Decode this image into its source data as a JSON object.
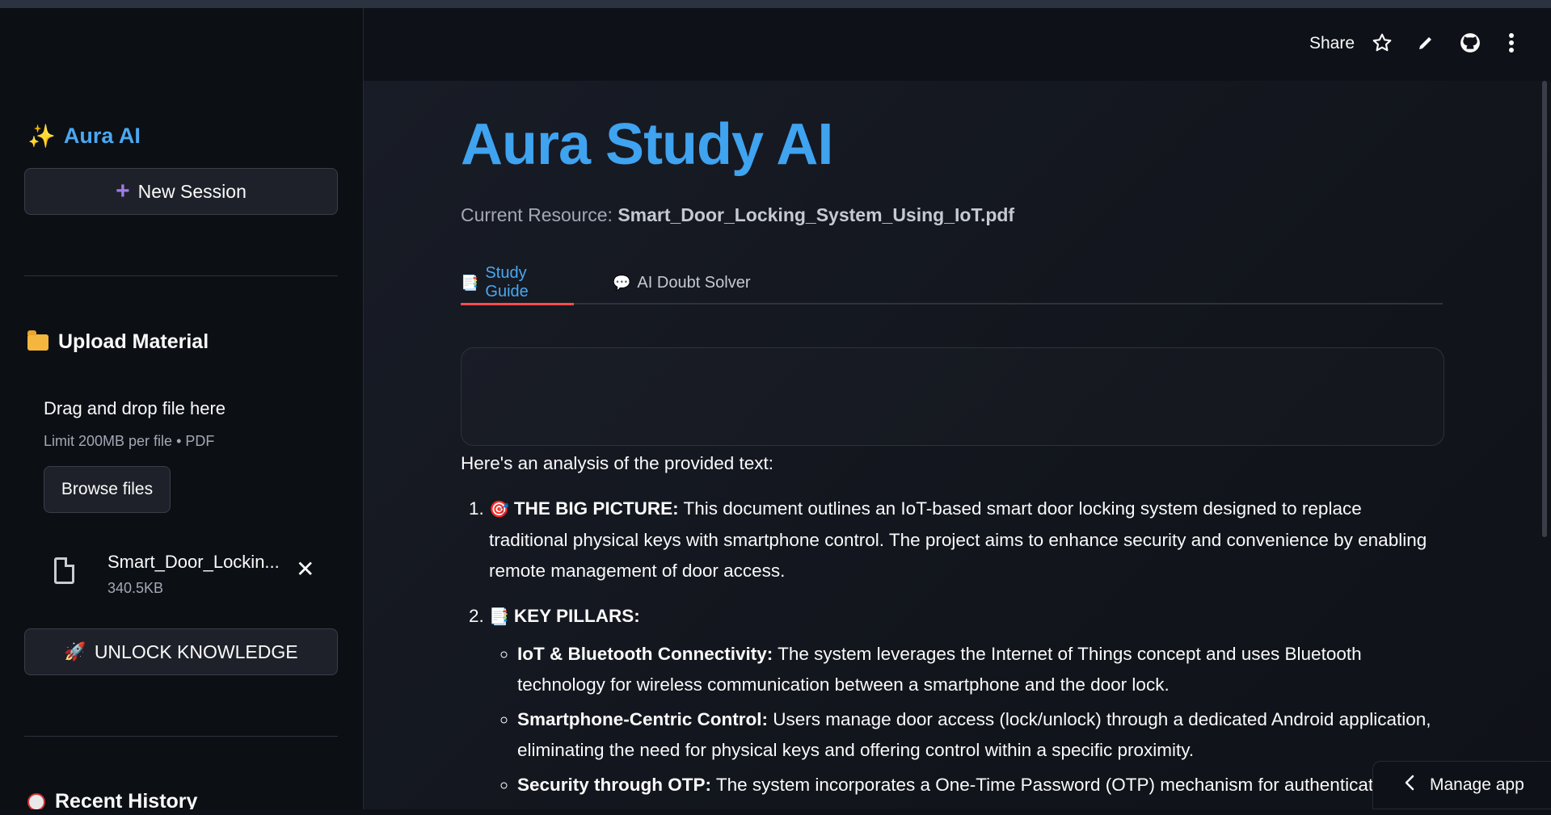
{
  "sidebar": {
    "brand": "Aura AI",
    "new_session_label": "New Session",
    "upload_title": "Upload Material",
    "dropzone_title": "Drag and drop file here",
    "dropzone_limit": "Limit 200MB per file • PDF",
    "browse_label": "Browse files",
    "file_name": "Smart_Door_Lockin...",
    "file_size": "340.5KB",
    "unlock_label": "UNLOCK KNOWLEDGE",
    "history_title": "Recent History"
  },
  "header": {
    "share_label": "Share"
  },
  "main": {
    "title": "Aura Study AI",
    "resource_label": "Current Resource:",
    "resource_file": "Smart_Door_Locking_System_Using_IoT.pdf",
    "tabs": [
      {
        "label": "Study Guide"
      },
      {
        "label": "AI Doubt Solver"
      }
    ],
    "intro": "Here's an analysis of the provided text:",
    "item1_heading": "THE BIG PICTURE:",
    "item1_text": "This document outlines an IoT-based smart door locking system designed to replace traditional physical keys with smartphone control. The project aims to enhance security and convenience by enabling remote management of door access.",
    "item2_heading": "KEY PILLARS:",
    "pillars": [
      {
        "heading": "IoT & Bluetooth Connectivity:",
        "text": "The system leverages the Internet of Things concept and uses Bluetooth technology for wireless communication between a smartphone and the door lock."
      },
      {
        "heading": "Smartphone-Centric Control:",
        "text": "Users manage door access (lock/unlock) through a dedicated Android application, eliminating the need for physical keys and offering control within a specific proximity."
      },
      {
        "heading": "Security through OTP:",
        "text": "The system incorporates a One-Time Password (OTP) mechanism for authentication"
      }
    ]
  },
  "manage_app_label": "Manage app",
  "colors": {
    "accent_blue": "#3fa3f0",
    "tab_underline": "#ff4b4b",
    "background": "#0e1117"
  }
}
